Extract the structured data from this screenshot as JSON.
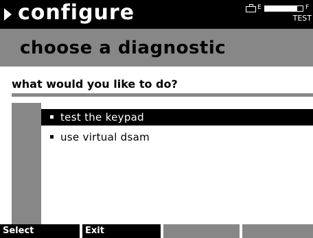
{
  "header": {
    "title": "configure",
    "battery": {
      "empty_label": "E",
      "full_label": "F",
      "level": 0.86
    },
    "mode": "TEST"
  },
  "subtitle": "choose a diagnostic",
  "prompt": "what would you like to do?",
  "menu": {
    "items": [
      {
        "label": "test the keypad",
        "selected": true
      },
      {
        "label": "use virtual dsam",
        "selected": false
      }
    ]
  },
  "softkeys": [
    {
      "label": "Select"
    },
    {
      "label": "Exit"
    },
    {
      "label": ""
    },
    {
      "label": ""
    }
  ],
  "colors": {
    "black": "#000000",
    "gray": "#878787",
    "white": "#ffffff"
  }
}
